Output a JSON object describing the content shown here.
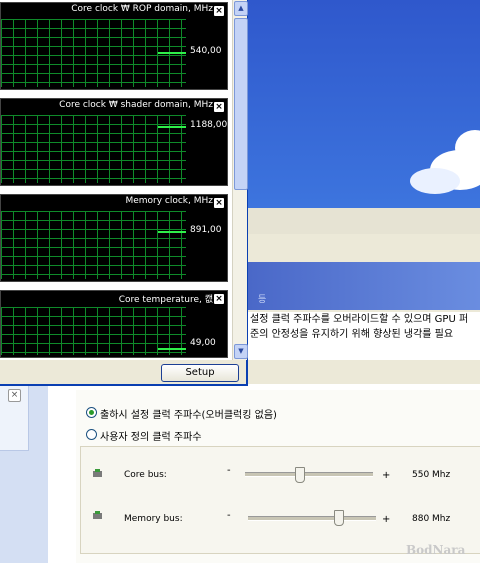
{
  "monitor": {
    "graphs": [
      {
        "title": "Core clock ₩ ROP domain, MHz",
        "value": "540,00"
      },
      {
        "title": "Core clock ₩ shader domain, MHz",
        "value": "1188,00"
      },
      {
        "title": "Memory clock, MHz",
        "value": "891,00"
      },
      {
        "title": "Core temperature, 캢",
        "value": "49,00"
      }
    ],
    "setup_label": "Setup",
    "graph_close": "×"
  },
  "background_app": {
    "section_label": "등",
    "description_lines": [
      "설정 클럭 주파수를 오버라이드할 수 있으며 GPU 퍼",
      "준의 안정성을 유지하기 위해 향상된 냉각를 필요"
    ]
  },
  "clock_panel": {
    "radio_options": [
      {
        "label": "출하시 설정 클럭 주파수(오버클럭킹 없음)",
        "selected": true
      },
      {
        "label": "사용자 정의 클럭 주파수",
        "selected": false
      }
    ],
    "buses": [
      {
        "name": "Core bus:",
        "minus": "-",
        "plus": "+",
        "value": "550 Mhz",
        "position": 0.42
      },
      {
        "name": "Memory bus:",
        "minus": "-",
        "plus": "+",
        "value": "880 Mhz",
        "position": 0.68
      }
    ]
  },
  "left_panel": {
    "close": "×"
  },
  "watermark": "BodNara",
  "colors": {
    "graph_grid": "#0f8a2a",
    "graph_line": "#2ff04a",
    "xp_blue": "#0a3fb2"
  }
}
